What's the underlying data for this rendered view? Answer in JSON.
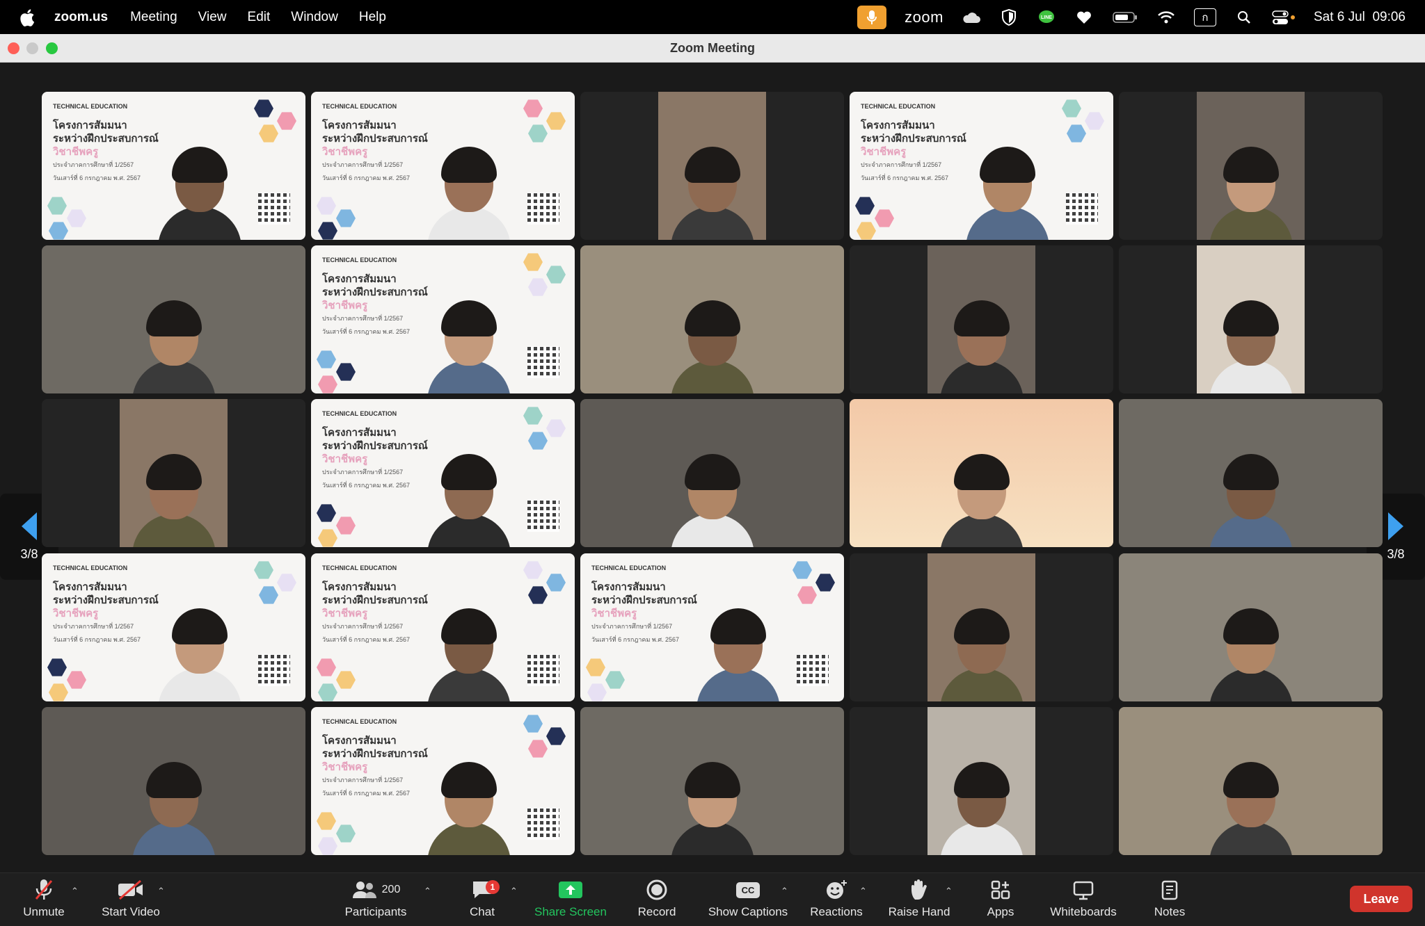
{
  "menubar": {
    "app": "zoom.us",
    "items": [
      "Meeting",
      "View",
      "Edit",
      "Window",
      "Help"
    ],
    "zoom_word": "zoom",
    "clock": "Sat 6 Jul  09:06",
    "keyboard_indicator": "ก"
  },
  "window": {
    "title": "Zoom Meeting"
  },
  "gallery": {
    "page_left": "3/8",
    "page_right": "3/8",
    "slide": {
      "logo": "TECHNICAL EDUCATION",
      "line1": "โครงการสัมมนา",
      "line2": "ระหว่างฝึกประสบการณ์",
      "accent": "วิชาชีพครู",
      "line3": "ประจำภาคการศึกษาที่ 1/2567",
      "line4": "วันเสาร์ที่ 6 กรกฎาคม พ.ศ. 2567"
    }
  },
  "toolbar": {
    "unmute": "Unmute",
    "start_video": "Start Video",
    "participants": "Participants",
    "participant_count": "200",
    "chat": "Chat",
    "chat_badge": "1",
    "share_screen": "Share Screen",
    "record": "Record",
    "show_captions": "Show Captions",
    "captions_icon": "CC",
    "reactions": "Reactions",
    "raise_hand": "Raise Hand",
    "apps": "Apps",
    "whiteboards": "Whiteboards",
    "notes": "Notes",
    "leave": "Leave"
  },
  "colors": {
    "share_green": "#23c55e",
    "leave_red": "#d0342c",
    "pager_blue": "#3ea0f0",
    "mic_orange": "#f0a030"
  }
}
